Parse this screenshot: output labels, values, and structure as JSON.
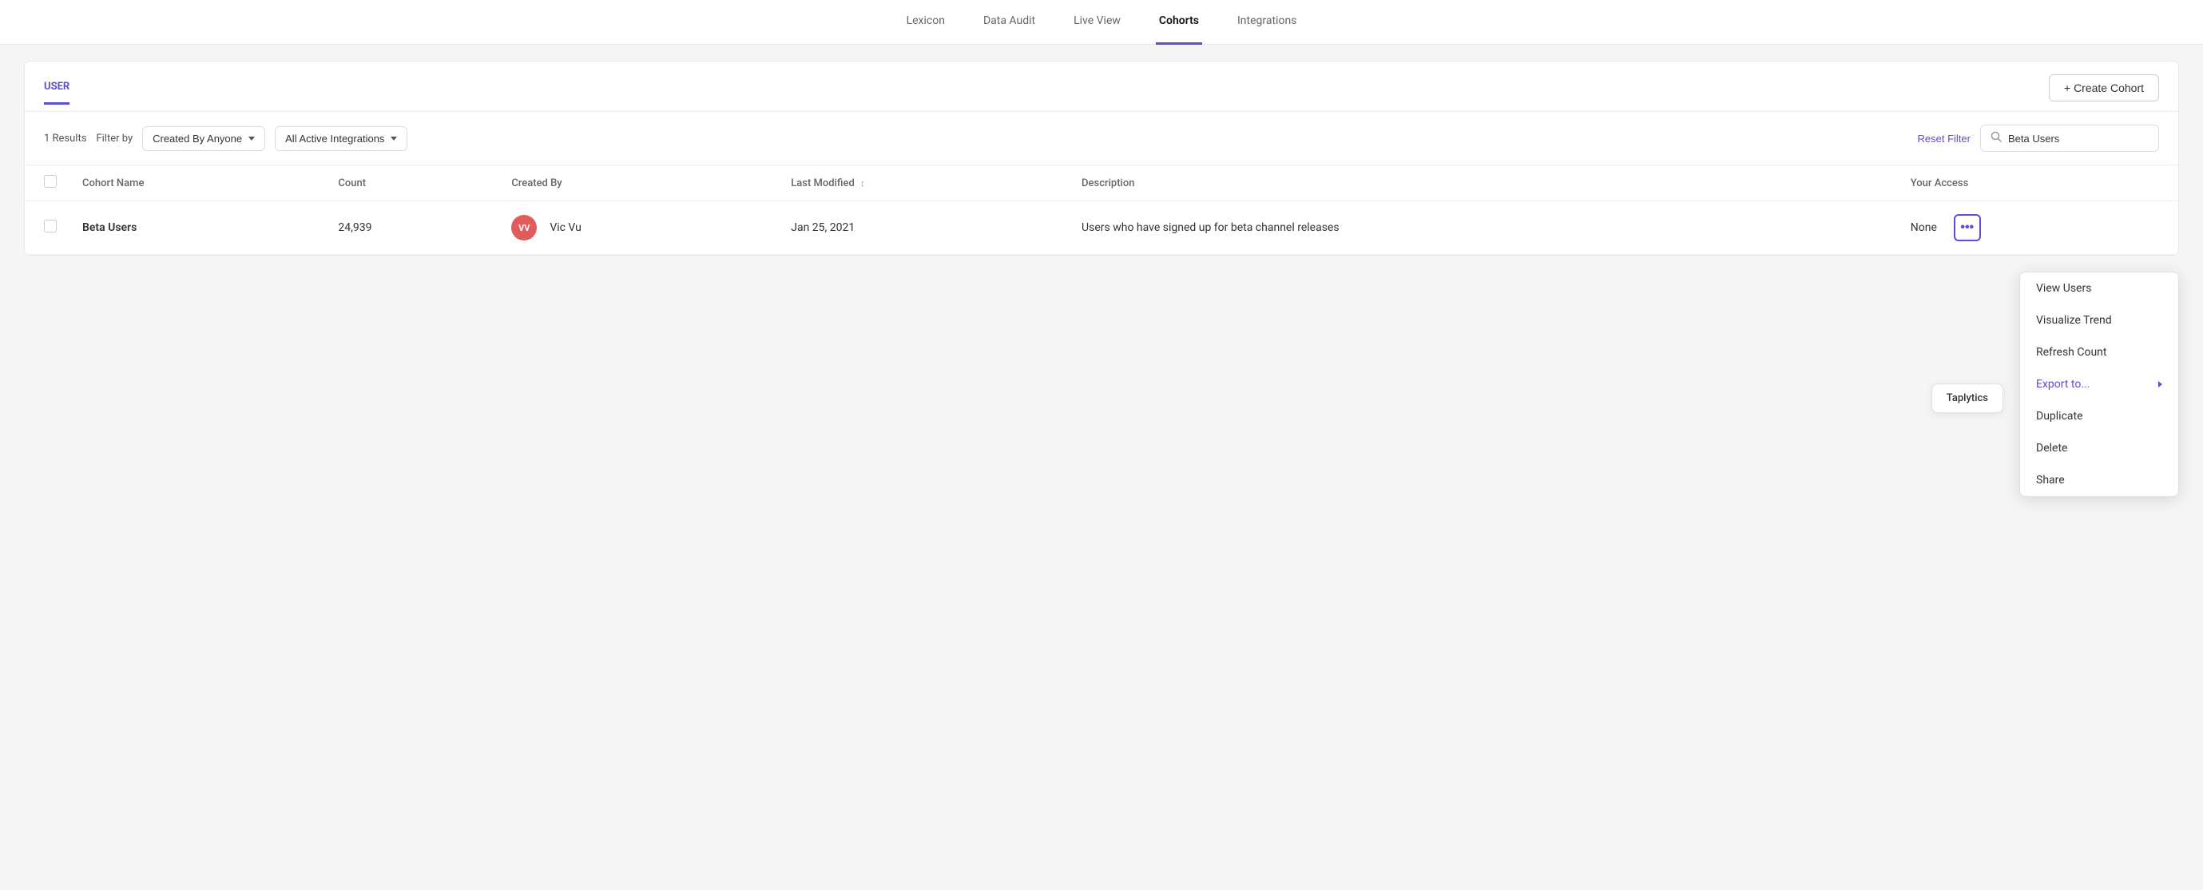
{
  "nav": {
    "items": [
      {
        "id": "lexicon",
        "label": "Lexicon",
        "active": false
      },
      {
        "id": "data-audit",
        "label": "Data Audit",
        "active": false
      },
      {
        "id": "live-view",
        "label": "Live View",
        "active": false
      },
      {
        "id": "cohorts",
        "label": "Cohorts",
        "active": true
      },
      {
        "id": "integrations",
        "label": "Integrations",
        "active": false
      }
    ]
  },
  "page": {
    "tab": "USER",
    "create_btn": "+ Create Cohort",
    "results_label": "1 Results",
    "filter_by_label": "Filter by",
    "created_by_filter": "Created By Anyone",
    "integrations_filter": "All Active Integrations",
    "reset_filter_label": "Reset Filter",
    "search_placeholder": "Beta Users",
    "search_value": "Beta Users"
  },
  "table": {
    "headers": [
      {
        "id": "name",
        "label": "Cohort Name"
      },
      {
        "id": "count",
        "label": "Count"
      },
      {
        "id": "created_by",
        "label": "Created By"
      },
      {
        "id": "last_modified",
        "label": "Last Modified",
        "sortable": true
      },
      {
        "id": "description",
        "label": "Description"
      },
      {
        "id": "your_access",
        "label": "Your Access"
      }
    ],
    "rows": [
      {
        "name": "Beta Users",
        "count": "24,939",
        "created_by_initials": "VV",
        "created_by_name": "Vic Vu",
        "last_modified": "Jan 25, 2021",
        "description": "Users who have signed up for beta channel releases",
        "access": "None"
      }
    ]
  },
  "context_menu": {
    "items": [
      {
        "id": "view-users",
        "label": "View Users",
        "has_arrow": false
      },
      {
        "id": "visualize-trend",
        "label": "Visualize Trend",
        "has_arrow": false
      },
      {
        "id": "refresh-count",
        "label": "Refresh Count",
        "has_arrow": false
      },
      {
        "id": "export-to",
        "label": "Export to...",
        "has_arrow": true,
        "accent": true
      },
      {
        "id": "duplicate",
        "label": "Duplicate",
        "has_arrow": false
      },
      {
        "id": "delete",
        "label": "Delete",
        "has_arrow": false
      },
      {
        "id": "share",
        "label": "Share",
        "has_arrow": false
      }
    ]
  },
  "taplytics": {
    "label": "Taplytics"
  }
}
